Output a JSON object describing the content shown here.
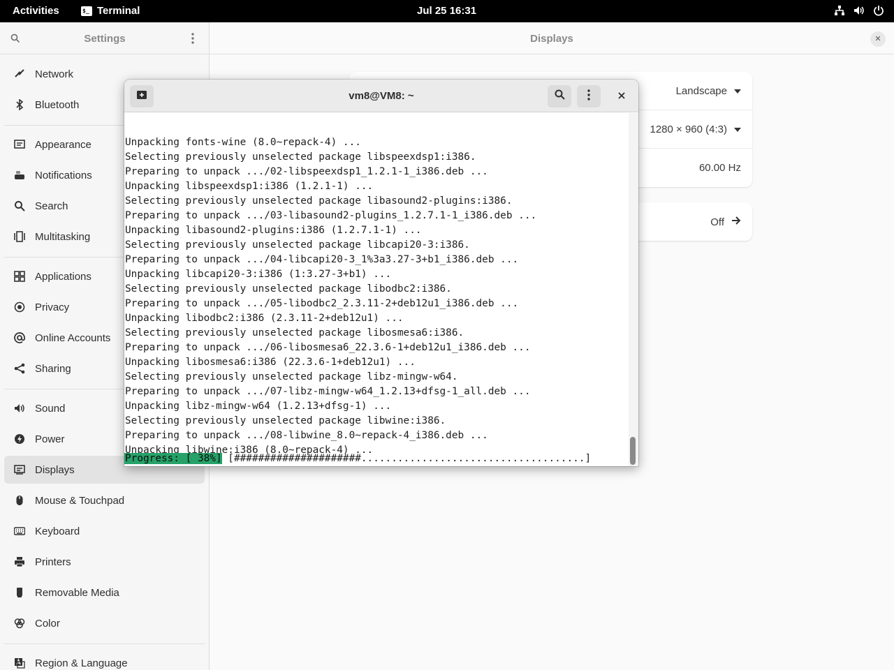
{
  "topbar": {
    "activities": "Activities",
    "app_name": "Terminal",
    "clock": "Jul 25  16:31"
  },
  "settings": {
    "sidebar_title": "Settings",
    "main_title": "Displays",
    "items": [
      {
        "label": "Network",
        "icon": "network-icon"
      },
      {
        "label": "Bluetooth",
        "icon": "bluetooth-icon"
      },
      {
        "label": "Appearance",
        "icon": "appearance-icon"
      },
      {
        "label": "Notifications",
        "icon": "notifications-icon"
      },
      {
        "label": "Search",
        "icon": "search-icon"
      },
      {
        "label": "Multitasking",
        "icon": "multitasking-icon"
      },
      {
        "label": "Applications",
        "icon": "applications-icon"
      },
      {
        "label": "Privacy",
        "icon": "privacy-icon"
      },
      {
        "label": "Online Accounts",
        "icon": "online-accounts-icon"
      },
      {
        "label": "Sharing",
        "icon": "sharing-icon"
      },
      {
        "label": "Sound",
        "icon": "sound-icon"
      },
      {
        "label": "Power",
        "icon": "power-icon"
      },
      {
        "label": "Displays",
        "icon": "displays-icon"
      },
      {
        "label": "Mouse & Touchpad",
        "icon": "mouse-icon"
      },
      {
        "label": "Keyboard",
        "icon": "keyboard-icon"
      },
      {
        "label": "Printers",
        "icon": "printer-icon"
      },
      {
        "label": "Removable Media",
        "icon": "removable-media-icon"
      },
      {
        "label": "Color",
        "icon": "color-icon"
      },
      {
        "label": "Region & Language",
        "icon": "region-icon"
      }
    ],
    "active_item": "Displays",
    "display": {
      "orientation": "Landscape",
      "resolution": "1280 × 960 (4:3)",
      "refresh_rate": "60.00 Hz",
      "night_light": "Off"
    }
  },
  "terminal": {
    "title": "vm8@VM8: ~",
    "lines": [
      "Unpacking fonts-wine (8.0~repack-4) ...",
      "Selecting previously unselected package libspeexdsp1:i386.",
      "Preparing to unpack .../02-libspeexdsp1_1.2.1-1_i386.deb ...",
      "Unpacking libspeexdsp1:i386 (1.2.1-1) ...",
      "Selecting previously unselected package libasound2-plugins:i386.",
      "Preparing to unpack .../03-libasound2-plugins_1.2.7.1-1_i386.deb ...",
      "Unpacking libasound2-plugins:i386 (1.2.7.1-1) ...",
      "Selecting previously unselected package libcapi20-3:i386.",
      "Preparing to unpack .../04-libcapi20-3_1%3a3.27-3+b1_i386.deb ...",
      "Unpacking libcapi20-3:i386 (1:3.27-3+b1) ...",
      "Selecting previously unselected package libodbc2:i386.",
      "Preparing to unpack .../05-libodbc2_2.3.11-2+deb12u1_i386.deb ...",
      "Unpacking libodbc2:i386 (2.3.11-2+deb12u1) ...",
      "Selecting previously unselected package libosmesa6:i386.",
      "Preparing to unpack .../06-libosmesa6_22.3.6-1+deb12u1_i386.deb ...",
      "Unpacking libosmesa6:i386 (22.3.6-1+deb12u1) ...",
      "Selecting previously unselected package libz-mingw-w64.",
      "Preparing to unpack .../07-libz-mingw-w64_1.2.13+dfsg-1_all.deb ...",
      "Unpacking libz-mingw-w64 (1.2.13+dfsg-1) ...",
      "Selecting previously unselected package libwine:i386.",
      "Preparing to unpack .../08-libwine_8.0~repack-4_i386.deb ...",
      "Unpacking libwine:i386 (8.0~repack-4) ...",
      ""
    ],
    "progress_label": "Progress: [ 38%]",
    "progress_bar": " [#####################.....................................]",
    "progress_percent": 38,
    "accent_color": "#26a269"
  }
}
